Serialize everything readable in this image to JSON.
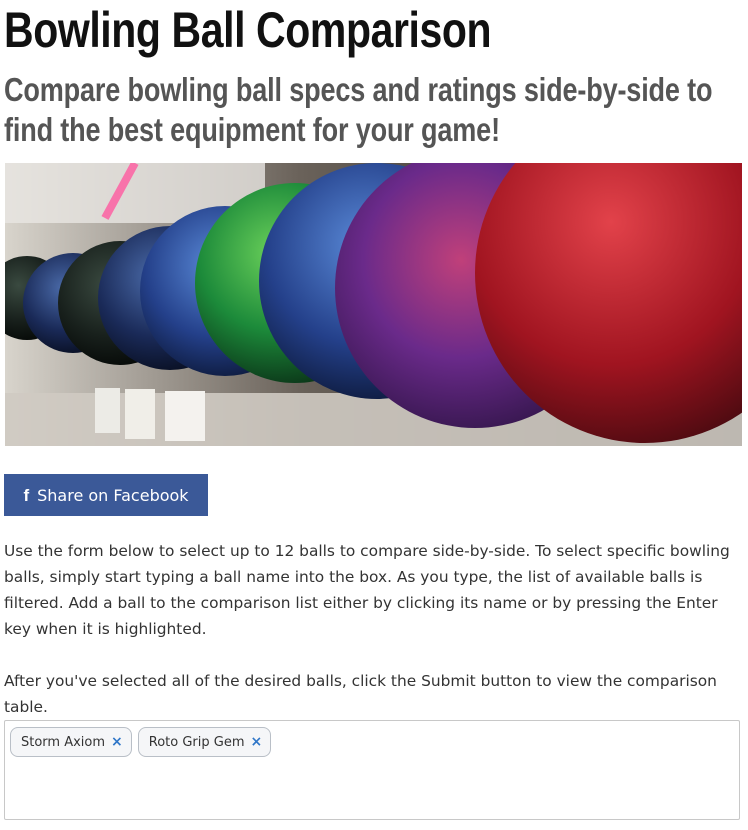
{
  "page": {
    "title": "Bowling Ball Comparison",
    "subtitle": "Compare bowling ball specs and ratings side-by-side to find the best equipment for your game!"
  },
  "hero_image": {
    "subject": "row of bowling balls on a shelf"
  },
  "share": {
    "icon": "facebook-icon",
    "icon_glyph": "f",
    "label": "Share on Facebook",
    "color": "#3b5998"
  },
  "instructions": {
    "paragraph1": "Use the form below to select up to 12 balls to compare side-by-side. To select specific bowling balls, simply start typing a ball name into the box. As you type, the list of available balls is filtered. Add a ball to the comparison list either by clicking its name or by pressing the Enter key when it is highlighted.",
    "paragraph2": "After you've selected all of the desired balls, click the Submit button to view the comparison table."
  },
  "selector": {
    "selected": [
      {
        "label": "Storm Axiom",
        "remove": "×"
      },
      {
        "label": "Roto Grip Gem",
        "remove": "×"
      }
    ]
  }
}
